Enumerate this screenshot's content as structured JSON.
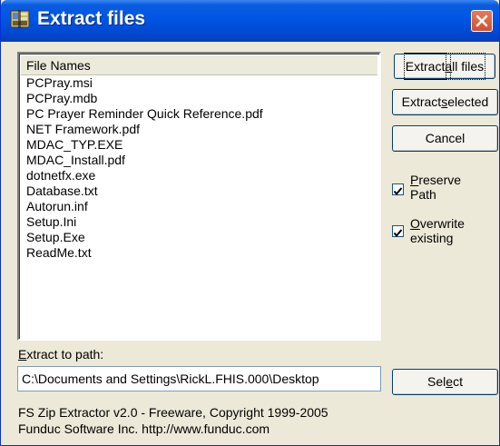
{
  "window": {
    "title": "Extract files",
    "app_icon": "zip-extractor-icon",
    "close_icon": "close-icon",
    "accent_color": "#0055e5",
    "close_color": "#d0502c"
  },
  "file_list": {
    "header": "File Names",
    "items": [
      "PCPray.msi",
      "PCPray.mdb",
      "PC Prayer Reminder Quick Reference.pdf",
      "NET Framework.pdf",
      "MDAC_TYP.EXE",
      "MDAC_Install.pdf",
      "dotnetfx.exe",
      "Database.txt",
      "Autorun.inf",
      "Setup.Ini",
      "Setup.Exe",
      "ReadMe.txt"
    ]
  },
  "buttons": {
    "extract_all": {
      "before": "Extract ",
      "accel": "a",
      "after": "ll files"
    },
    "extract_selected": {
      "before": "Extract ",
      "accel": "s",
      "after": "elected"
    },
    "cancel": "Cancel",
    "select": {
      "before": "Sel",
      "accel": "e",
      "after": "ct"
    }
  },
  "options": {
    "preserve_path": {
      "accel": "P",
      "rest_line1": "reserve",
      "line2": "Path",
      "checked": true
    },
    "overwrite_existing": {
      "accel": "O",
      "rest_line1": "verwrite",
      "line2": "existing",
      "checked": true
    }
  },
  "path": {
    "label_accel": "E",
    "label_rest": "xtract to path:",
    "value": "C:\\Documents and Settings\\RickL.FHIS.000\\Desktop"
  },
  "footer": {
    "line1": "FS Zip Extractor v2.0 - Freeware, Copyright 1999-2005",
    "line2": "Funduc Software Inc. http://www.funduc.com"
  }
}
